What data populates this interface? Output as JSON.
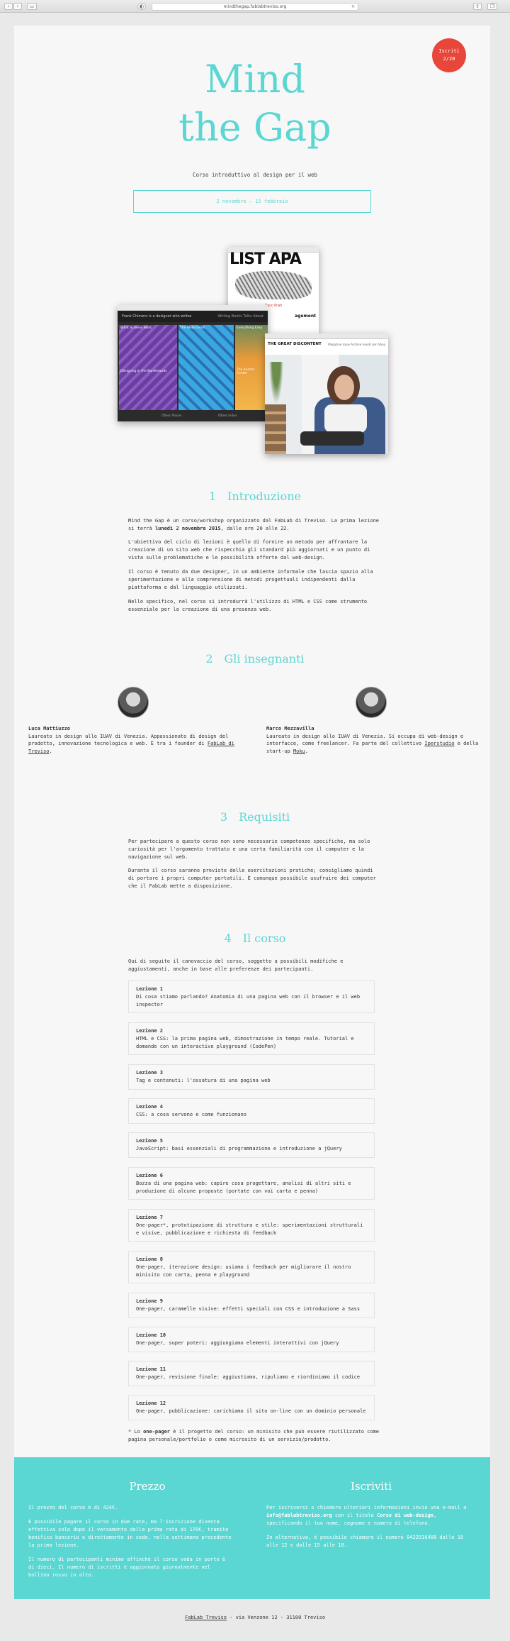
{
  "browser": {
    "url": "mindthegap.fablabtreviso.org"
  },
  "badge": {
    "line1": "Iscriti",
    "line2": "2/20"
  },
  "hero": {
    "title_line1": "Mind",
    "title_line2": "the Gap",
    "subtitle": "Corso introduttivo al design per il web",
    "dates": "2 novembre — 15 febbraio"
  },
  "screenshots": {
    "a_big": "LIST APA",
    "a_caption": "Zacc Prah",
    "a_caption2": "agement",
    "b_nav": "Frank Chimero is a designer who writes",
    "b_nav_links": "Writing   Books   Talks   About",
    "b_tile1": "What Screens Want",
    "b_tile2": "The Webs Grain",
    "b_tile3": "Everything Easy",
    "b_tile4": "Designing in the Borderlands",
    "b_tile5": "The Anchor Center",
    "b_bottom1": "Other Places",
    "b_bottom2": "Other Index",
    "c_head": "THE GREAT DISCONTENT",
    "c_links": "Magazine   Issue Archive   Goods   Join   Shop"
  },
  "sections": {
    "intro": {
      "num": "1",
      "title": "Introduzione",
      "p1_a": "Mind the Gap è un corso/workshop organizzato dal FabLab di Treviso. La prima lezione si terrà ",
      "p1_b": "lunedì 2 novembre 2015",
      "p1_c": ", dalle ore 20 alle 22.",
      "p2": "L'obiettivo del ciclo di lezioni è quello di fornire un metodo per affrontare la creazione di un sito web che rispecchia gli standard più aggiornati e un punto di vista sulle problematiche e le possibilità offerte dal web-design.",
      "p3": "Il corso è tenuto da due designer, in un ambiente informale che lascia spazio alla sperimentazione e alla comprensione di metodi progettuali indipendenti dalla piattaforma e dal linguaggio utilizzati.",
      "p4": "Nello specifico, nel corso si introdurrà l'utilizzo di HTML e CSS come strumento essenziale per la creazione di una presenza web."
    },
    "teachers": {
      "num": "2",
      "title": "Gli insegnanti",
      "t1_name": "Luca Mattiuzzo",
      "t1_bio": "Laureato in design allo IUAV di Venezia. Appassionato di design del prodotto, innovazione tecnologica e web. È tra i founder di ",
      "t1_link": "FabLab di Treviso",
      "t1_end": ".",
      "t2_name": "Marco Mezzavilla",
      "t2_bio": "Laureato in design allo IUAV di Venezia. Si occupa di web-design e interfacce, come freelancer. Fa parte del collettivo ",
      "t2_link": "Iperstudio",
      "t2_mid": " e della start-up ",
      "t2_link2": "Moku",
      "t2_end": "."
    },
    "req": {
      "num": "3",
      "title": "Requisiti",
      "p1": "Per partecipare a questo corso non sono necessarie competenze specifiche, ma solo curiosità per l'argomento trattato e una certa familiarità con il computer e la navigazione sul web.",
      "p2": "Durante il corso saranno previste delle esercitazioni pratiche; consigliamo quindi di portare i propri computer portatili. È comunque possibile usufruire dei computer che il FabLab mette a disposizione."
    },
    "course": {
      "num": "4",
      "title": "Il corso",
      "intro": "Qui di seguito il canovaccio del corso, soggetto a possibili modifiche e aggiustamenti, anche in base alle preferenze dei partecipanti.",
      "lessons": [
        {
          "name": "Lezione 1",
          "desc": "Di cosa stiamo parlando? Anatomia di una pagina web con il browser e il web inspector"
        },
        {
          "name": "Lezione 2",
          "desc": "HTML e CSS: la prima pagina web, dimostrazione in tempo reale. Tutorial e domande con un interactive playground (CodePen)"
        },
        {
          "name": "Lezione 3",
          "desc": "Tag e contenuti: l'ossatura di una pagina web"
        },
        {
          "name": "Lezione 4",
          "desc": "CSS: a cosa servono e come funzionano"
        },
        {
          "name": "Lezione 5",
          "desc": "JavaScript: basi essenziali di programmazione e introduzione a jQuery"
        },
        {
          "name": "Lezione 6",
          "desc": "Bozza di una pagina web: capire cosa progettare, analisi di altri siti e produzione di alcune proposte (portate con voi carta e penna)"
        },
        {
          "name": "Lezione 7",
          "desc": "One-pager*, prototipazione di struttura e stile: sperimentazioni strutturali e visive, pubblicazione e richiesta di feedback"
        },
        {
          "name": "Lezione 8",
          "desc": "One-pager, iterazione design: usiamo i feedback per migliorare il nostro minisito con carta, penna e playground"
        },
        {
          "name": "Lezione 9",
          "desc": "One-pager, caramelle visive: effetti speciali con CSS e introduzione a Sass"
        },
        {
          "name": "Lezione 10",
          "desc": "One-pager, super poteri: aggiungiamo elementi interattivi con jQuery"
        },
        {
          "name": "Lezione 11",
          "desc": "One-pager, revisione finale: aggiustiamo, ripuliamo e riordiniamo il codice"
        },
        {
          "name": "Lezione 12",
          "desc": "One-pager, pubblicazione: carichiamo il sito on-line con un dominio personale"
        }
      ],
      "note_a": "* Lo ",
      "note_b": "one-pager",
      "note_c": " è il progetto del corso: un minisito che può essere riutilizzato come pagina personale/portfolio o come microsito di un servizio/prodotto."
    }
  },
  "footer_teal": {
    "price_title": "Prezzo",
    "price_p1": "Il prezzo del corso è di 424€.",
    "price_p2": "È possibile pagare il corso in due rate, ma l'iscrizione diventa effettiva solo dopo il versamento della prima rata di 170€, tramite bonifico bancario o direttamente in sede, nella settimana precedente la prima lezione.",
    "price_p3": "Il numero di partecipanti minimo affinché il corso vada in porto è di dieci. Il numero di iscritti è aggiornato giornalmente nel bollino rosso in alto.",
    "sub_title": "Iscriviti",
    "sub_p1_a": "Per iscriversi o chiedere ulteriori informazioni invia una e-mail a ",
    "sub_p1_b": "info@fablabtreviso.org",
    "sub_p1_c": " con il titolo ",
    "sub_p1_d": "Corso di web-design",
    "sub_p1_e": ", specificando il tuo nome, cognome e numero di telefono.",
    "sub_p2": "In alternativa, è possibile chiamare il numero 0422916468 dalle 10 alle 12 e dalle 15 alle 18."
  },
  "footer": {
    "link": "FabLab Treviso",
    "rest": " · via Venzone 12 · 31100 Treviso"
  }
}
